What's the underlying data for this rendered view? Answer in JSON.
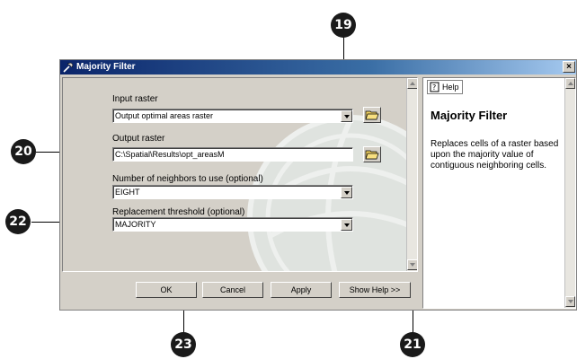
{
  "window": {
    "title": "Majority Filter",
    "close": "×"
  },
  "tool": {
    "input_raster": {
      "label": "Input raster",
      "value": "Output optimal areas raster"
    },
    "output_raster": {
      "label": "Output raster",
      "value": "C:\\Spatial\\Results\\opt_areasM"
    },
    "neighbors": {
      "label": "Number of neighbors to use (optional)",
      "value": "EIGHT"
    },
    "threshold": {
      "label": "Replacement threshold (optional)",
      "value": "MAJORITY"
    }
  },
  "buttons": {
    "ok": "OK",
    "cancel": "Cancel",
    "apply": "Apply",
    "show_help": "Show Help >>"
  },
  "help": {
    "tab": "Help",
    "title": "Majority Filter",
    "body": "Replaces cells of a raster based upon the majority value of contiguous neighboring cells."
  },
  "callouts": {
    "c19": "19",
    "c20": "20",
    "c21": "21",
    "c22": "22",
    "c23": "23"
  },
  "icons": {
    "title": "hammer-tool-icon",
    "browse": "open-folder-icon",
    "help": "help-book-icon",
    "dropdown": "dropdown-arrow-icon"
  }
}
